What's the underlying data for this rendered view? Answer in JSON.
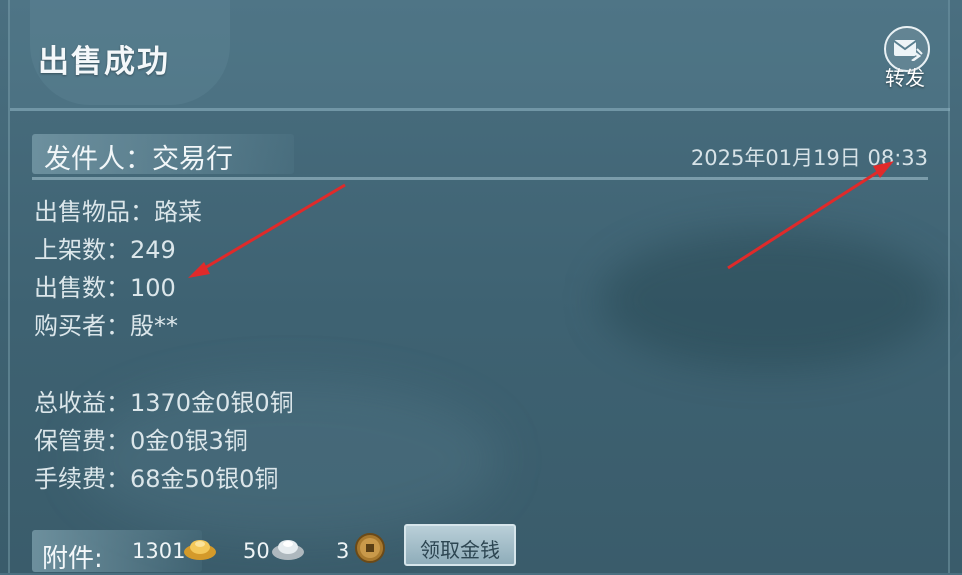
{
  "header": {
    "title": "出售成功",
    "forward_label": "转发"
  },
  "mail": {
    "sender": "发件人：交易行",
    "date": "2025年01月19日  08:33"
  },
  "details": {
    "item": "出售物品：路菜",
    "listed": "上架数：249",
    "sold": "出售数：100",
    "buyer": "购买者：殷**",
    "total_income": "总收益：1370金0银0铜",
    "storage_fee": "保管费：0金0银3铜",
    "handling_fee": "手续费：68金50银0铜"
  },
  "attachments": {
    "label": "附件:",
    "gold": "1301",
    "silver": "50",
    "copper": "3",
    "claim_button": "领取金钱"
  },
  "colors": {
    "arrow": "#e02a2a",
    "gold": "#e8b84a",
    "silver": "#d9dfe3",
    "copper": "#b58a3c"
  },
  "icons": {
    "forward": "mail-forward-icon",
    "gold": "gold-ingot-icon",
    "silver": "silver-ingot-icon",
    "copper": "copper-coin-icon"
  }
}
